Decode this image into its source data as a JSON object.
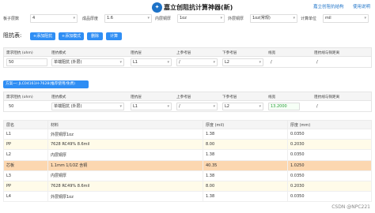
{
  "header": {
    "logo_glyph": "✦",
    "title": "嘉立创阻抗计算神器(新)",
    "links": [
      "嘉立创阻抗结构",
      "使用说明"
    ]
  },
  "config": [
    {
      "label": "板子层数",
      "value": "4"
    },
    {
      "label": "成品厚度",
      "value": "1.6"
    },
    {
      "label": "内层铜厚",
      "value": "1oz"
    },
    {
      "label": "外层铜厚",
      "value": "1oz(常规)"
    },
    {
      "label": "计算单位",
      "value": "mil"
    }
  ],
  "impedance_section": {
    "title": "阻抗表:",
    "buttons": [
      "+添加阻抗",
      "+添加模式",
      "删除",
      "计算"
    ]
  },
  "grid_headers": [
    "需求阻抗 (ohm)",
    "阻抗模式",
    "阻抗层",
    "上参考层",
    "下参考层",
    "线宽",
    "阻抗线与铜距离"
  ],
  "row1": {
    "ohm": "50",
    "mode": "单端阻抗 (外层)",
    "layer": "L1",
    "up": "/",
    "down": "L2",
    "width": "/",
    "dist": "/"
  },
  "plan": {
    "label": "方案一: JLC04161H-7628(推荐使用/免费)"
  },
  "row2": {
    "ohm": "50",
    "mode": "单端阻抗 (外层)",
    "layer": "L1",
    "up": "/",
    "down": "L2",
    "width": "13.2000",
    "dist": "/"
  },
  "stack_table": {
    "headers": [
      "层名",
      "材料",
      "厚度 (mil)",
      "厚度 (mm)"
    ],
    "rows": [
      {
        "name": "L1",
        "material": "外层铜厚1oz",
        "mil": "1.38",
        "mm": "0.0350",
        "kind": "odd"
      },
      {
        "name": "PP",
        "material": "7628 RC49% 8.6mil",
        "mil": "8.00",
        "mm": "0.2030",
        "kind": "even"
      },
      {
        "name": "L2",
        "material": "内层铜厚",
        "mil": "1.38",
        "mm": "0.0350",
        "kind": "odd"
      },
      {
        "name": "芯板",
        "material": "1.1mm 1/1OZ 含铜",
        "mil": "40.35",
        "mm": "1.0250",
        "kind": "core"
      },
      {
        "name": "L3",
        "material": "内层铜厚",
        "mil": "1.38",
        "mm": "0.0350",
        "kind": "odd"
      },
      {
        "name": "PP",
        "material": "7628 RC49% 8.6mil",
        "mil": "8.00",
        "mm": "0.2030",
        "kind": "even"
      },
      {
        "name": "L4",
        "material": "外层铜厚1oz",
        "mil": "1.38",
        "mm": "0.0350",
        "kind": "odd"
      }
    ]
  },
  "watermark": "CSDN @NPC221"
}
